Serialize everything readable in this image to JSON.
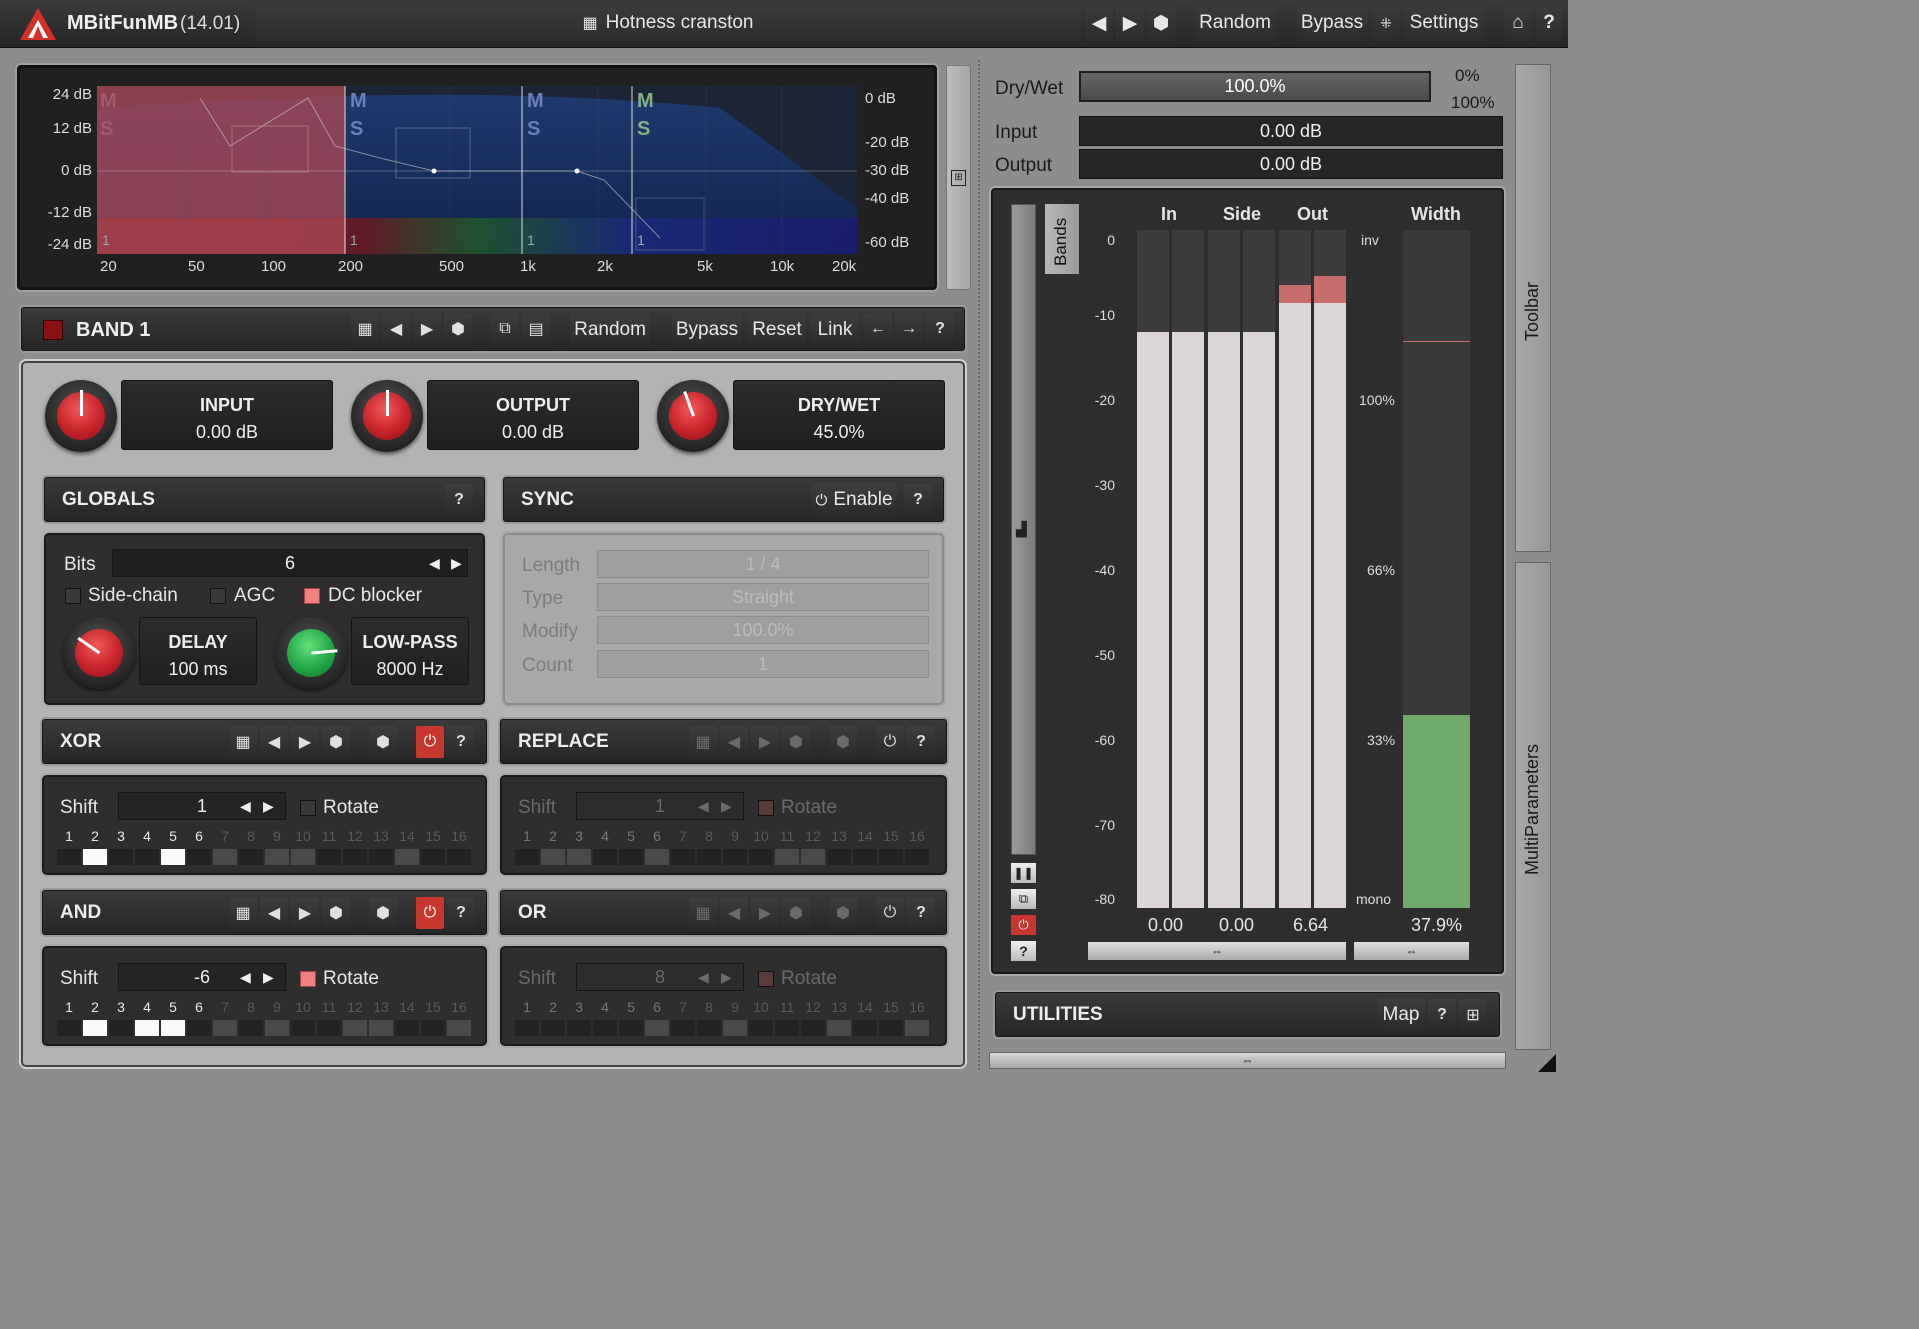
{
  "titlebar": {
    "app_name": "MBitFunMB",
    "version": "(14.01)",
    "preset": "Hotness cranston",
    "random": "Random",
    "bypass": "Bypass",
    "settings": "Settings",
    "help": "?"
  },
  "graph": {
    "db_left": [
      "24 dB",
      "12 dB",
      "0 dB",
      "-12 dB",
      "-24 dB"
    ],
    "db_right": [
      "0 dB",
      "-20 dB",
      "-30 dB",
      "-40 dB",
      "-60 dB"
    ],
    "freq": [
      "20",
      "50",
      "100",
      "200",
      "500",
      "1k",
      "2k",
      "5k",
      "10k",
      "20k"
    ],
    "band_ms": [
      "M",
      "S"
    ],
    "band_marker": "1"
  },
  "band": {
    "name": "BAND 1",
    "random": "Random",
    "bypass": "Bypass",
    "reset": "Reset",
    "link": "Link",
    "help": "?"
  },
  "knobs": {
    "input": {
      "title": "INPUT",
      "value": "0.00 dB"
    },
    "output": {
      "title": "OUTPUT",
      "value": "0.00 dB"
    },
    "drywet": {
      "title": "DRY/WET",
      "value": "45.0%"
    },
    "delay": {
      "title": "DELAY",
      "value": "100 ms"
    },
    "lowpass": {
      "title": "LOW-PASS",
      "value": "8000 Hz"
    }
  },
  "globals": {
    "title": "GLOBALS",
    "help": "?",
    "bits_label": "Bits",
    "bits_value": "6",
    "sidechain": "Side-chain",
    "agc": "AGC",
    "dcblocker": "DC blocker"
  },
  "sync": {
    "title": "SYNC",
    "enable": "Enable",
    "help": "?",
    "length_label": "Length",
    "length_value": "1 / 4",
    "type_label": "Type",
    "type_value": "Straight",
    "modify_label": "Modify",
    "modify_value": "100.0%",
    "count_label": "Count",
    "count_value": "1"
  },
  "modules": {
    "xor": {
      "title": "XOR",
      "shift_label": "Shift",
      "shift_value": "1",
      "rotate": "Rotate",
      "help": "?"
    },
    "replace": {
      "title": "REPLACE",
      "shift_label": "Shift",
      "shift_value": "1",
      "rotate": "Rotate",
      "help": "?"
    },
    "and": {
      "title": "AND",
      "shift_label": "Shift",
      "shift_value": "-6",
      "rotate": "Rotate",
      "help": "?"
    },
    "or": {
      "title": "OR",
      "shift_label": "Shift",
      "shift_value": "8",
      "rotate": "Rotate",
      "help": "?"
    }
  },
  "bit_numbers": [
    "1",
    "2",
    "3",
    "4",
    "5",
    "6",
    "7",
    "8",
    "9",
    "10",
    "11",
    "12",
    "13",
    "14",
    "15",
    "16"
  ],
  "right": {
    "drywet_label": "Dry/Wet",
    "drywet_value": "100.0%",
    "drywet_min": "0%",
    "drywet_max": "100%",
    "input_label": "Input",
    "input_value": "0.00 dB",
    "output_label": "Output",
    "output_value": "0.00 dB",
    "toolbar": "Toolbar",
    "multiparams": "MultiParameters"
  },
  "meters": {
    "bands_tab": "Bands",
    "heads": {
      "in": "In",
      "side": "Side",
      "out": "Out",
      "width": "Width"
    },
    "scale": [
      "0",
      "-10",
      "-20",
      "-30",
      "-40",
      "-50",
      "-60",
      "-70",
      "-80"
    ],
    "width_scale": [
      "inv",
      "100%",
      "66%",
      "33%",
      "mono"
    ],
    "values": {
      "in": "0.00",
      "side": "0.00",
      "out": "6.64",
      "width": "37.9%"
    },
    "help": "?"
  },
  "utilities": {
    "title": "UTILITIES",
    "map": "Map",
    "help": "?"
  },
  "colors": {
    "accent_red": "#c8372d",
    "knob_green": "#22a845",
    "meter_fill": "#dcd6d6",
    "width_green": "#6faa6a"
  }
}
